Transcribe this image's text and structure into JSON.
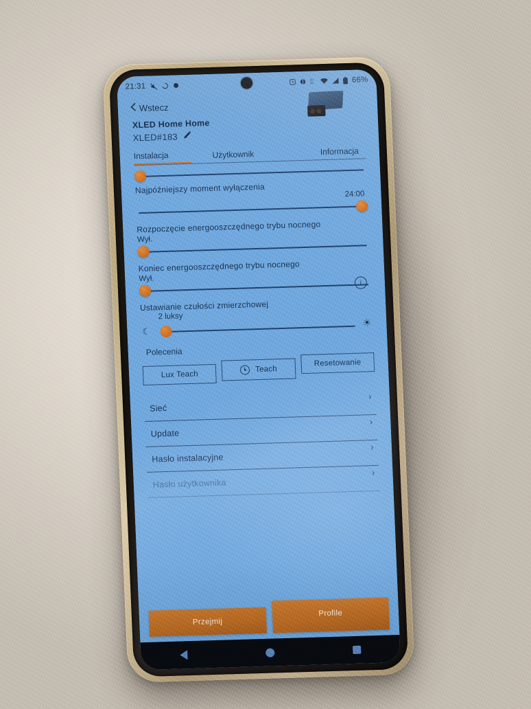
{
  "statusbar": {
    "time": "21:31",
    "left_icons": [
      "mute-icon",
      "sync-icon",
      "dot-icon"
    ],
    "right_icons": [
      "alarm-icon",
      "vibrate-icon",
      "dnd-icon",
      "wifi-icon",
      "signal-icon",
      "battery-icon"
    ],
    "battery": "66%"
  },
  "nav": {
    "back_label": "Wstecz",
    "back_icon": "chevron-left-icon"
  },
  "device": {
    "title": "XLED Home Home",
    "name": "XLED#183",
    "edit_icon": "pencil-icon",
    "thumbnail": "floodlight-sensor-thumbnail"
  },
  "tabs": [
    {
      "label": "Instalacja",
      "active": true
    },
    {
      "label": "Użytkownik",
      "active": false
    },
    {
      "label": "Informacja",
      "active": false
    }
  ],
  "settings": [
    {
      "label": "Najpóźniejszy moment wyłączenia",
      "value": "24:00",
      "value_align": "right",
      "thumb_position": "right"
    },
    {
      "label": "Rozpoczęcie energooszczędnego trybu nocnego",
      "value": "Wył.",
      "value_align": "left",
      "thumb_position": "left"
    },
    {
      "label": "Koniec energooszczędnego trybu nocnego",
      "value": "Wył.",
      "value_align": "left",
      "thumb_position": "left"
    }
  ],
  "twilight": {
    "info_icon": "info-icon",
    "label": "Ustawianie czułości zmierzchowej",
    "value": "2 luksy",
    "moon_icon": "moon-icon",
    "sun_icon": "sun-icon"
  },
  "commands": {
    "title": "Polecenia",
    "buttons": [
      {
        "label": "Lux Teach",
        "icon": null
      },
      {
        "label": "Teach",
        "icon": "clock-icon"
      },
      {
        "label": "Resetowanie",
        "icon": null
      }
    ]
  },
  "list": [
    {
      "label": "Sieć",
      "chevron": "chevron-right-icon",
      "disabled": false
    },
    {
      "label": "Update",
      "chevron": "chevron-right-icon",
      "disabled": false
    },
    {
      "label": "Hasło instalacyjne",
      "chevron": "chevron-right-icon",
      "disabled": false
    },
    {
      "label": "Hasło użytkownika",
      "chevron": "chevron-right-icon",
      "disabled": true
    }
  ],
  "actions": [
    {
      "label": "Przejmij"
    },
    {
      "label": "Profile"
    }
  ],
  "navbar": {
    "back_icon": "triangle-back-icon",
    "home_icon": "circle-home-icon",
    "recents_icon": "square-recents-icon"
  },
  "colors": {
    "app_background": "#6ea6dd",
    "accent": "#c9772c",
    "text": "#16304e",
    "separator": "#2b4a71"
  }
}
